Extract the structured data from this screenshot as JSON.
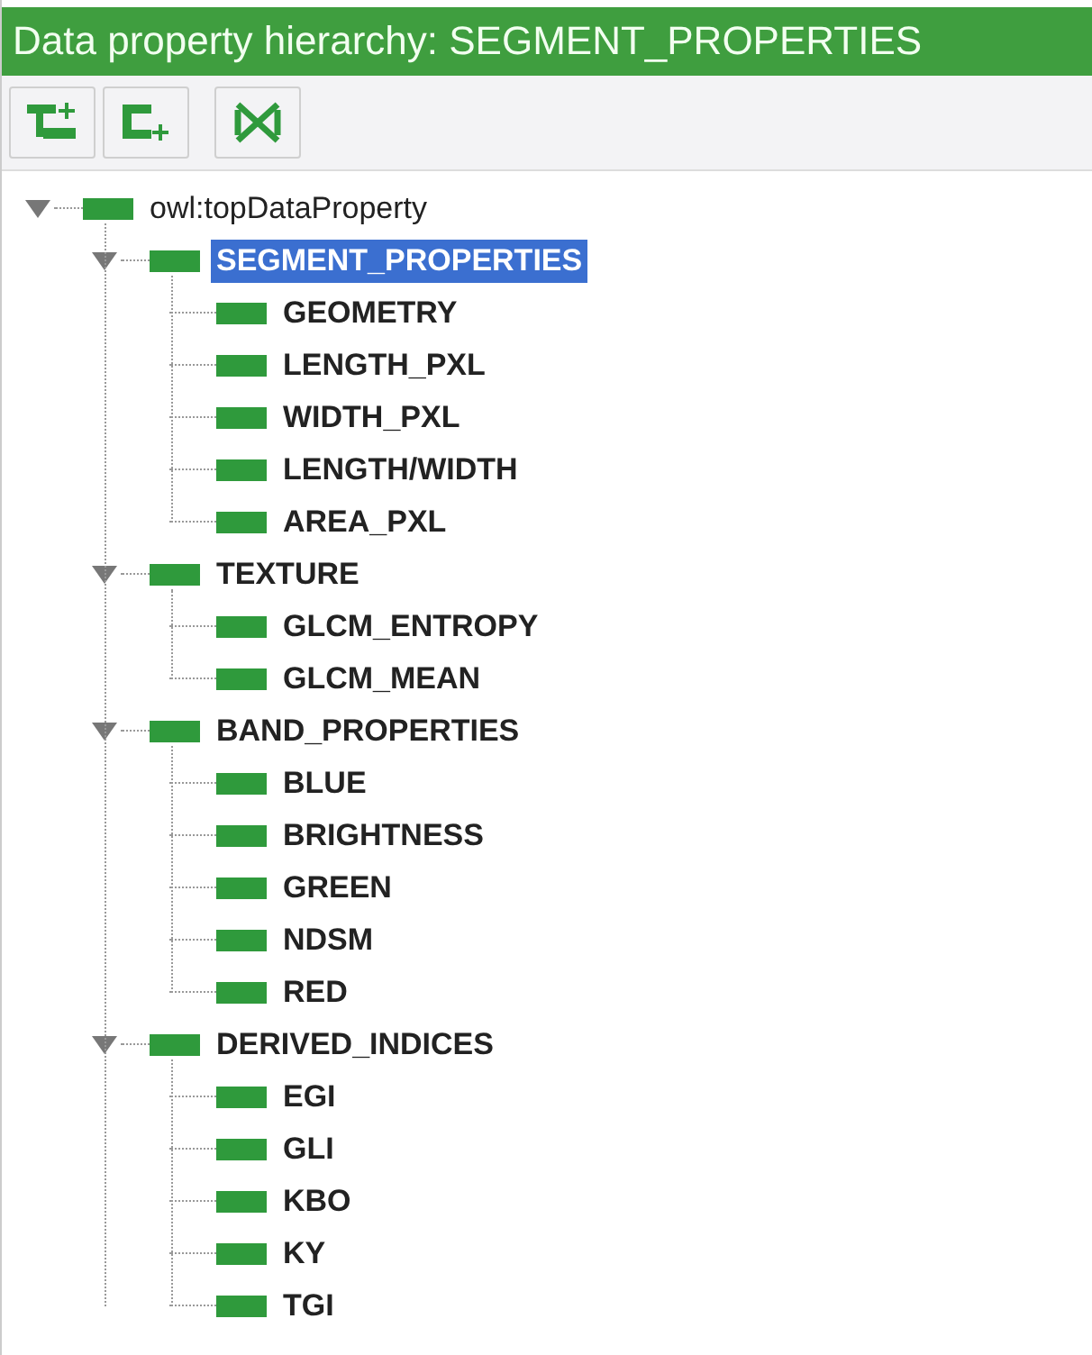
{
  "window": {
    "title": "Data property hierarchy: SEGMENT_PROPERTIES"
  },
  "toolbar": [
    {
      "kind": "add-sub"
    },
    {
      "kind": "add-sibling"
    },
    {
      "kind": "delete"
    }
  ],
  "tree": [
    {
      "label": "owl:topDataProperty",
      "bold": false,
      "selected": false,
      "expanded": true,
      "children": [
        {
          "label": "SEGMENT_PROPERTIES",
          "bold": true,
          "selected": true,
          "expanded": true,
          "children": [
            {
              "label": "GEOMETRY",
              "bold": true,
              "selected": false
            },
            {
              "label": "LENGTH_PXL",
              "bold": true,
              "selected": false
            },
            {
              "label": "WIDTH_PXL",
              "bold": true,
              "selected": false
            },
            {
              "label": "LENGTH/WIDTH",
              "bold": true,
              "selected": false
            },
            {
              "label": "AREA_PXL",
              "bold": true,
              "selected": false
            }
          ]
        },
        {
          "label": "TEXTURE",
          "bold": true,
          "selected": false,
          "expanded": true,
          "children": [
            {
              "label": "GLCM_ENTROPY",
              "bold": true,
              "selected": false
            },
            {
              "label": "GLCM_MEAN",
              "bold": true,
              "selected": false
            }
          ]
        },
        {
          "label": "BAND_PROPERTIES",
          "bold": true,
          "selected": false,
          "expanded": true,
          "children": [
            {
              "label": "BLUE",
              "bold": true,
              "selected": false
            },
            {
              "label": "BRIGHTNESS",
              "bold": true,
              "selected": false
            },
            {
              "label": "GREEN",
              "bold": true,
              "selected": false
            },
            {
              "label": "NDSM",
              "bold": true,
              "selected": false
            },
            {
              "label": "RED",
              "bold": true,
              "selected": false
            }
          ]
        },
        {
          "label": "DERIVED_INDICES",
          "bold": true,
          "selected": false,
          "expanded": true,
          "children": [
            {
              "label": "EGI",
              "bold": true,
              "selected": false
            },
            {
              "label": "GLI",
              "bold": true,
              "selected": false
            },
            {
              "label": "KBO",
              "bold": true,
              "selected": false
            },
            {
              "label": "KY",
              "bold": true,
              "selected": false
            },
            {
              "label": "TGI",
              "bold": true,
              "selected": false
            }
          ]
        }
      ]
    }
  ]
}
